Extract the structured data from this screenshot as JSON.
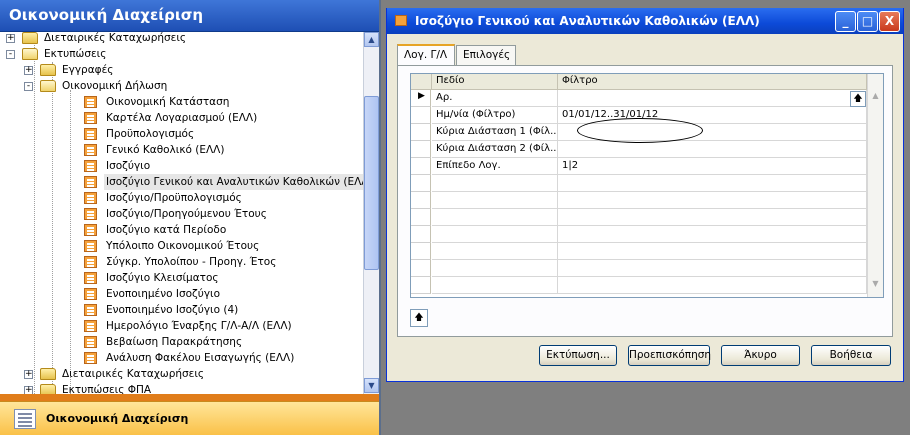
{
  "nav": {
    "title": "Οικονομική Διαχείριση",
    "bottom_label": "Οικονομική Διαχείριση",
    "tree": [
      {
        "label": "Διεταιρικές Καταχωρήσεις",
        "kind": "folder",
        "level": 1,
        "expander": "+"
      },
      {
        "label": "Εκτυπώσεις",
        "kind": "folder-open",
        "level": 1,
        "expander": "−"
      },
      {
        "label": "Εγγραφές",
        "kind": "folder",
        "level": 2,
        "expander": "+"
      },
      {
        "label": "Οικονομική Δήλωση",
        "kind": "folder-open",
        "level": 2,
        "expander": "−"
      },
      {
        "label": "Οικονομική Κατάσταση",
        "kind": "report",
        "level": 3
      },
      {
        "label": "Καρτέλα Λογαριασμού (ΕΛΛ)",
        "kind": "report",
        "level": 3
      },
      {
        "label": "Προϋπολογισμός",
        "kind": "report",
        "level": 3
      },
      {
        "label": "Γενικό Καθολικό (ΕΛΛ)",
        "kind": "report",
        "level": 3
      },
      {
        "label": "Ισοζύγιο",
        "kind": "report",
        "level": 3
      },
      {
        "label": "Ισοζύγιο Γενικού και Αναλυτικών Καθολικών (ΕΛΛ)",
        "kind": "report",
        "level": 3,
        "selected": true
      },
      {
        "label": "Ισοζύγιο/Προϋπολογισμός",
        "kind": "report",
        "level": 3
      },
      {
        "label": "Ισοζύγιο/Προηγούμενου Έτους",
        "kind": "report",
        "level": 3
      },
      {
        "label": "Ισοζύγιο κατά Περίοδο",
        "kind": "report",
        "level": 3
      },
      {
        "label": "Υπόλοιπο Οικονομικού Έτους",
        "kind": "report",
        "level": 3
      },
      {
        "label": "Σύγκρ. Υπολοίπου - Προηγ. Έτος",
        "kind": "report",
        "level": 3
      },
      {
        "label": "Ισοζύγιο Κλεισίματος",
        "kind": "report",
        "level": 3
      },
      {
        "label": "Ενοποιημένο Ισοζύγιο",
        "kind": "report",
        "level": 3
      },
      {
        "label": "Ενοποιημένο Ισοζύγιο (4)",
        "kind": "report",
        "level": 3
      },
      {
        "label": "Ημερολόγιο Έναρξης Γ/Λ-Α/Λ (ΕΛΛ)",
        "kind": "report",
        "level": 3
      },
      {
        "label": "Βεβαίωση Παρακράτησης",
        "kind": "report",
        "level": 3
      },
      {
        "label": "Ανάλυση Φακέλου Εισαγωγής (ΕΛΛ)",
        "kind": "report",
        "level": 3
      },
      {
        "label": "Διεταιρικές Καταχωρήσεις",
        "kind": "folder",
        "level": 2,
        "expander": "+"
      },
      {
        "label": "Εκτυπώσεις ΦΠΑ",
        "kind": "folder",
        "level": 2,
        "expander": "+"
      }
    ]
  },
  "dialog": {
    "title": "Ισοζύγιο Γενικού και Αναλυτικών Καθολικών (ΕΛΛ)",
    "tabs": [
      "Λογ. Γ/Λ",
      "Επιλογές"
    ],
    "columns": [
      "Πεδίο",
      "Φίλτρο"
    ],
    "rows": [
      {
        "field": "Αρ.",
        "filter": ""
      },
      {
        "field": "Ημ/νία (Φίλτρο)",
        "filter": "01/01/12..31/01/12"
      },
      {
        "field": "Κύρια Διάσταση 1 (Φίλ...",
        "filter": ""
      },
      {
        "field": "Κύρια Διάσταση 2 (Φίλ...",
        "filter": ""
      },
      {
        "field": "Επίπεδο Λογ.",
        "filter": "1|2"
      }
    ],
    "buttons": {
      "print": "Εκτύπωση...",
      "preview": "Προεπισκόπηση",
      "cancel": "Άκυρο",
      "help": "Βοήθεια"
    },
    "window_buttons": {
      "minimize": "_",
      "maximize": "□",
      "close": "X"
    }
  }
}
